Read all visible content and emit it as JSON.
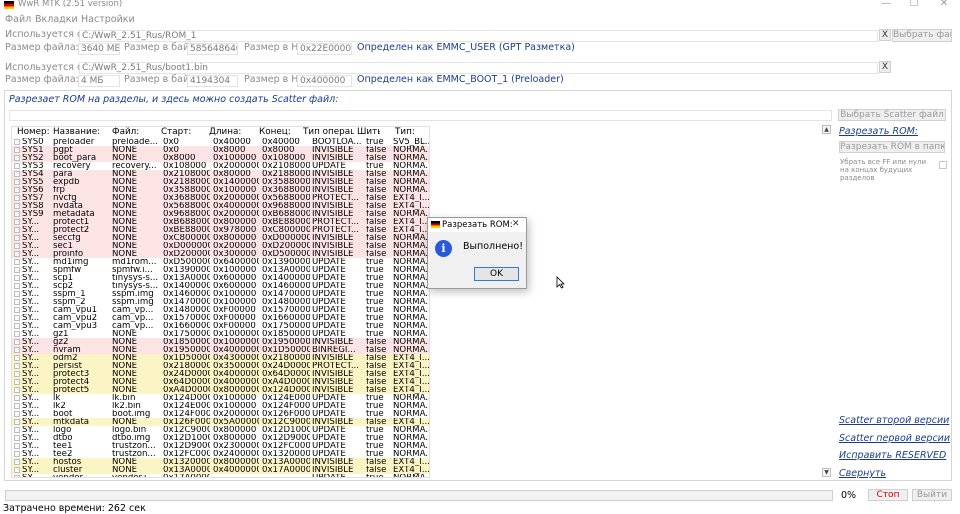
{
  "window": {
    "title": "WwR MTK (2.51 version)",
    "minimize": "—",
    "maximize": "☐",
    "close": "✕"
  },
  "menu": [
    "Файл",
    "Вкладки",
    "Настройки"
  ],
  "source1": {
    "label": "Используется фа",
    "path": "C:/WwR_2.51_Rus/ROM_1",
    "browse": "Выбрать файл",
    "clear": "X",
    "size_label": "Размер файла:",
    "size_value": "3640 МБ",
    "bytes_label": "Размер в байт",
    "bytes_value": "585648640",
    "hex_label": "Размер в HE",
    "hex_value": "0x22E000000",
    "detected": "Определен как EMMC_USER (GPT Разметка)"
  },
  "source2": {
    "label": "Используется фа",
    "path": "C:/WwR_2.51_Rus/boot1.bin",
    "clear": "X",
    "size_label": "Размер файла:",
    "size_value": "4 МБ",
    "bytes_label": "Размер в байт",
    "bytes_value": "4194304",
    "hex_label": "Размер в HE",
    "hex_value": "0x400000",
    "detected": "Определен как EMMC_BOOT_1 (Preloader)"
  },
  "panel": {
    "title": "Разрезает ROM на разделы, и здесь можно создать Scatter файл:",
    "select_scatter": "Выбрать Scatter файл",
    "split_rom": "Разрезать ROM:",
    "split_to_folder": "Разрезать ROM в папку.",
    "strip_note": "Убрать все FF или нули на концах будущих разделов",
    "scatter_second": "Scatter второй версии",
    "scatter_first": "Scatter первой версии",
    "fix_reserve": "Исправить RESERVED",
    "collapse": "Свернуть"
  },
  "table": {
    "headers": [
      "Номер:",
      "Название:",
      "Файл:",
      "Старт:",
      "Длина:",
      "Конец:",
      "Тип операции:",
      "Шить",
      "Тип:"
    ],
    "rows": [
      [
        "SYS0",
        "preloader",
        "preloade...",
        "0x0",
        "0x40000",
        "0x40000",
        "BOOTLOA...",
        "true",
        "SV5_BL..."
      ],
      [
        "SYS1",
        "pgpt",
        "NONE",
        "0x0",
        "0x8000",
        "0x8000",
        "INVISIBLE",
        "false",
        "NORMA..."
      ],
      [
        "SYS2",
        "boot_para",
        "NONE",
        "0x8000",
        "0x100000",
        "0x108000",
        "INVISIBLE",
        "false",
        "NORMA..."
      ],
      [
        "SYS3",
        "recovery",
        "recovery...",
        "0x108000",
        "0x2000000",
        "0x2108000",
        "UPDATE",
        "true",
        "NORMA..."
      ],
      [
        "SYS4",
        "para",
        "NONE",
        "0x2108000",
        "0x80000",
        "0x2188000",
        "INVISIBLE",
        "false",
        "NORMA..."
      ],
      [
        "SYS5",
        "expdb",
        "NONE",
        "0x2188000",
        "0x1400000",
        "0x3588000",
        "INVISIBLE",
        "false",
        "NORMA..."
      ],
      [
        "SYS6",
        "frp",
        "NONE",
        "0x3588000",
        "0x100000",
        "0x3688000",
        "INVISIBLE",
        "false",
        "NORMA..."
      ],
      [
        "SYS7",
        "nvcfg",
        "NONE",
        "0x3688000",
        "0x2000000",
        "0x5688000",
        "PROTECT...",
        "false",
        "EXT4_I..."
      ],
      [
        "SYS8",
        "nvdata",
        "NONE",
        "0x5688000",
        "0x4000000",
        "0x9688000",
        "INVISIBLE",
        "false",
        "EXT4_I..."
      ],
      [
        "SYS9",
        "metadata",
        "NONE",
        "0x9688000",
        "0x2000000",
        "0xB688000",
        "INVISIBLE",
        "false",
        "NORMA..."
      ],
      [
        "SY...",
        "protect1",
        "NONE",
        "0xB688000",
        "0x800000",
        "0xBE88000",
        "PROTECT...",
        "false",
        "EXT4_I..."
      ],
      [
        "SY...",
        "protect2",
        "NONE",
        "0xBE88000",
        "0x978000",
        "0xC800000",
        "PROTECT...",
        "false",
        "EXT4_I..."
      ],
      [
        "SY...",
        "seccfg",
        "NONE",
        "0xC800000",
        "0x800000",
        "0xD000000",
        "INVISIBLE",
        "false",
        "NORMA..."
      ],
      [
        "SY...",
        "sec1",
        "NONE",
        "0xD000000",
        "0x200000",
        "0xD200000",
        "INVISIBLE",
        "false",
        "NORMA..."
      ],
      [
        "SY...",
        "proinfo",
        "NONE",
        "0xD200000",
        "0x300000",
        "0xD500000",
        "INVISIBLE",
        "false",
        "NORMA..."
      ],
      [
        "SY...",
        "md1img",
        "md1rom...",
        "0xD500000",
        "0x6400000",
        "0x13900000",
        "UPDATE",
        "true",
        "NORMA..."
      ],
      [
        "SY...",
        "spmfw",
        "spmfw.i...",
        "0x13900000",
        "0x100000",
        "0x13A00000",
        "UPDATE",
        "true",
        "NORMA..."
      ],
      [
        "SY...",
        "scp1",
        "tinysys-s...",
        "0x13A00000",
        "0x600000",
        "0x14000000",
        "UPDATE",
        "true",
        "NORMA..."
      ],
      [
        "SY...",
        "scp2",
        "tinysys-s...",
        "0x14000000",
        "0x600000",
        "0x14600000",
        "UPDATE",
        "true",
        "NORMA..."
      ],
      [
        "SY...",
        "sspm_1",
        "sspm.img",
        "0x14600000",
        "0x100000",
        "0x14700000",
        "UPDATE",
        "true",
        "NORMA..."
      ],
      [
        "SY...",
        "sspm_2",
        "sspm.img",
        "0x14700000",
        "0x100000",
        "0x14800000",
        "UPDATE",
        "true",
        "NORMA..."
      ],
      [
        "SY...",
        "cam_vpu1",
        "cam_vp...",
        "0x14800000",
        "0xF00000",
        "0x15700000",
        "UPDATE",
        "true",
        "NORMA..."
      ],
      [
        "SY...",
        "cam_vpu2",
        "cam_vp...",
        "0x15700000",
        "0xF00000",
        "0x16600000",
        "UPDATE",
        "true",
        "NORMA..."
      ],
      [
        "SY...",
        "cam_vpu3",
        "cam_vp...",
        "0x16600000",
        "0xF00000",
        "0x17500000",
        "UPDATE",
        "true",
        "NORMA..."
      ],
      [
        "SY...",
        "gz1",
        "NONE",
        "0x17500000",
        "0x1000000",
        "0x18500000",
        "UPDATE",
        "true",
        "NORMA..."
      ],
      [
        "SY...",
        "gz2",
        "NONE",
        "0x18500000",
        "0x1000000",
        "0x19500000",
        "INVISIBLE",
        "false",
        "NORMA..."
      ],
      [
        "SY...",
        "nvram",
        "NONE",
        "0x19500000",
        "0x4000000",
        "0x1D500000",
        "BINREGI...",
        "false",
        "NORMA..."
      ],
      [
        "SY...",
        "odm2",
        "NONE",
        "0x1D500000",
        "0x4300000",
        "0x21800000",
        "INVISIBLE",
        "false",
        "EXT4_I..."
      ],
      [
        "SY...",
        "persist",
        "NONE",
        "0x21800000",
        "0x3500000",
        "0x24D00000",
        "PROTECT...",
        "false",
        "EXT4_I..."
      ],
      [
        "SY...",
        "protect3",
        "NONE",
        "0x24D00000",
        "0x4000000",
        "0x64D00000",
        "INVISIBLE",
        "false",
        "EXT4_I..."
      ],
      [
        "SY...",
        "protect4",
        "NONE",
        "0x64D00000",
        "0x4000000",
        "0xA4D00000",
        "INVISIBLE",
        "false",
        "EXT4_I..."
      ],
      [
        "SY...",
        "protect5",
        "NONE",
        "0xA4D00000",
        "0x8000000",
        "0x124D00000",
        "INVISIBLE",
        "false",
        "EXT4_I..."
      ],
      [
        "SY...",
        "lk",
        "lk.bin",
        "0x124D00000",
        "0x100000",
        "0x124E00000",
        "UPDATE",
        "true",
        "NORMA..."
      ],
      [
        "SY...",
        "lk2",
        "lk2.bin",
        "0x124E00000",
        "0x100000",
        "0x124F00000",
        "UPDATE",
        "true",
        "NORMA..."
      ],
      [
        "SY...",
        "boot",
        "boot.img",
        "0x124F00000",
        "0x2000000",
        "0x126F00000",
        "UPDATE",
        "true",
        "NORMA..."
      ],
      [
        "SY...",
        "mtkdata",
        "NONE",
        "0x126F00000",
        "0x5A00000",
        "0x12C900000",
        "INVISIBLE",
        "false",
        "EXT4_I..."
      ],
      [
        "SY...",
        "logo",
        "logo.bin",
        "0x12C900000",
        "0x800000",
        "0x12D100000",
        "UPDATE",
        "true",
        "NORMA..."
      ],
      [
        "SY...",
        "dtbo",
        "dtbo.img",
        "0x12D100000",
        "0x800000",
        "0x12D900000",
        "UPDATE",
        "true",
        "NORMA..."
      ],
      [
        "SY...",
        "tee1",
        "trustzon...",
        "0x12D900000",
        "0x2300000",
        "0x12FC00000",
        "UPDATE",
        "true",
        "NORMA..."
      ],
      [
        "SY...",
        "tee2",
        "trustzon...",
        "0x12FC00000",
        "0x2400000",
        "0x13200000",
        "UPDATE",
        "true",
        "NORMA..."
      ],
      [
        "SY...",
        "hostos",
        "NONE",
        "0x13200000",
        "0x8000000",
        "0x13A00000",
        "INVISIBLE",
        "false",
        "EXT4_I..."
      ],
      [
        "SY...",
        "cluster",
        "NONE",
        "0x13A00000",
        "0x4000000",
        "0x17A00000",
        "INVISIBLE",
        "false",
        "EXT4_I..."
      ],
      [
        "SY...",
        "vendor",
        "vendor.i...",
        "0x17A00000",
        "",
        "",
        "UPDATE",
        "true",
        "NORMA..."
      ]
    ]
  },
  "dialog": {
    "title": "Разрезать ROM:",
    "message": "Выполнено!",
    "ok": "OK"
  },
  "footer": {
    "progress_label": "0%",
    "progress": 0,
    "stop": "Стоп",
    "exit": "Выйти",
    "elapsed": "Затрачено времени: 262 сек"
  },
  "colors": {
    "row_pink": "#fde4e4",
    "row_yellow": "#fbf5c6",
    "link": "#1a3c8f",
    "stop_red": "#cc0000"
  },
  "icons": {
    "app": "german-flag-icon",
    "info": "info-icon"
  }
}
